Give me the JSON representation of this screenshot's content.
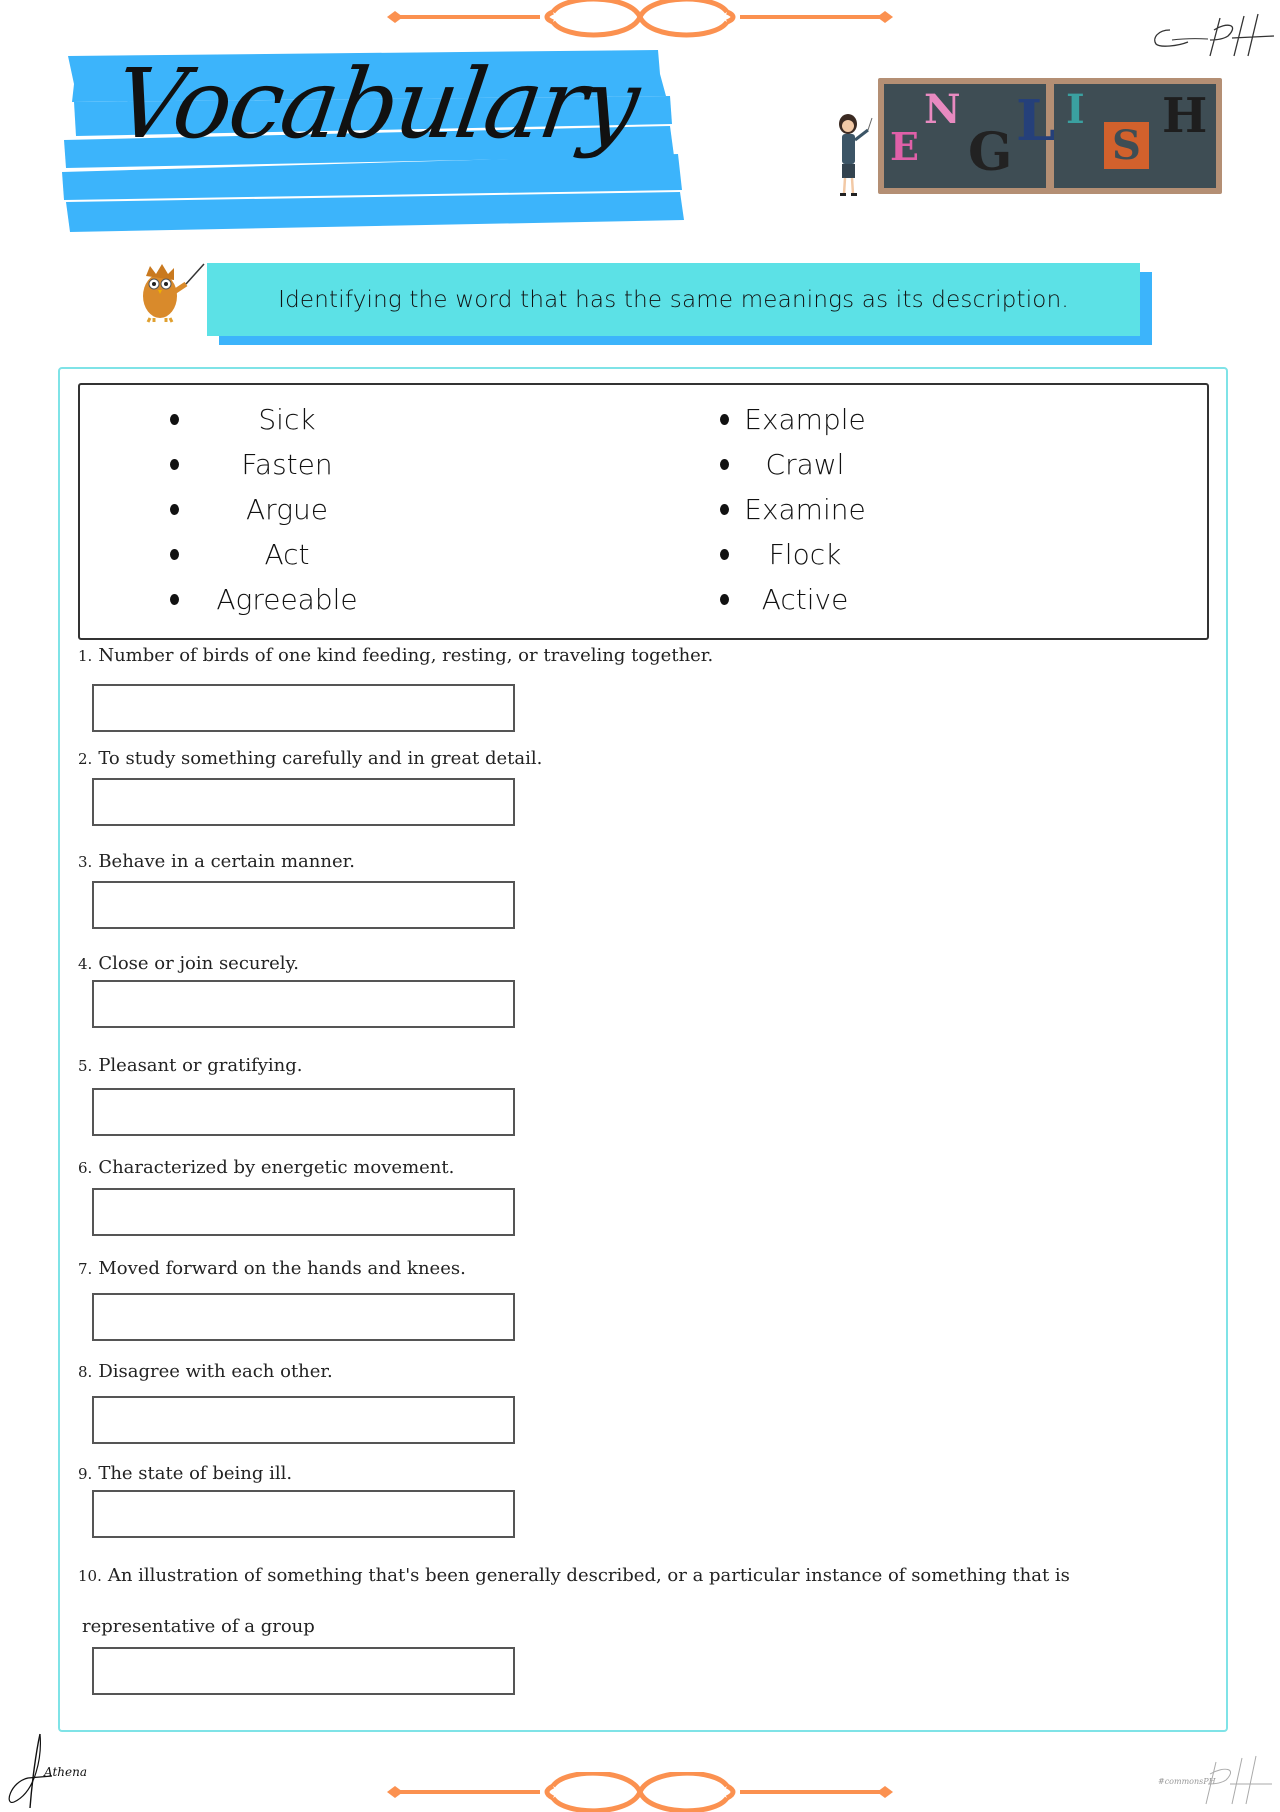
{
  "header": {
    "title": "Vocabulary",
    "title_banner_color": "#3cb4fb",
    "board_word": "ENGLISH",
    "board_letters": [
      "E",
      "N",
      "G",
      "L",
      "I",
      "S",
      "H"
    ],
    "top_signature": "CommonPH"
  },
  "instruction": {
    "text": "Identifying the word that has the same meanings as its description.",
    "box_color": "#5ce1e6",
    "shadow_color": "#3cb4fb",
    "mascot_icon": "owl-teacher-icon"
  },
  "word_bank": {
    "left": [
      "Sick",
      "Fasten",
      "Argue",
      "Act",
      "Agreeable"
    ],
    "right": [
      "Example",
      "Crawl",
      "Examine",
      "Flock",
      "Active"
    ]
  },
  "questions": [
    {
      "number": "1.",
      "text": "Number of birds of one kind feeding, resting, or traveling together.",
      "answer": ""
    },
    {
      "number": "2.",
      "text": "To study something carefully and in great detail.",
      "answer": ""
    },
    {
      "number": "3.",
      "text": "Behave in a certain manner.",
      "answer": ""
    },
    {
      "number": "4.",
      "text": "Close or join securely.",
      "answer": ""
    },
    {
      "number": "5.",
      "text": "Pleasant or gratifying.",
      "answer": ""
    },
    {
      "number": "6.",
      "text": "Characterized by energetic movement.",
      "answer": ""
    },
    {
      "number": "7.",
      "text": "Moved forward on the hands and knees.",
      "answer": ""
    },
    {
      "number": "8.",
      "text": "Disagree with each other.",
      "answer": ""
    },
    {
      "number": "9.",
      "text": "The state of being ill.",
      "answer": ""
    },
    {
      "number": "10.",
      "text": "An illustration of something that's been generally described, or a particular instance of something that is",
      "text_line2": "representative of a group",
      "answer": ""
    }
  ],
  "footer": {
    "left_signature": "Athena",
    "right_signature": "#commonsPH"
  },
  "colors": {
    "ornament": "#fb9150",
    "frame": "#7fe3e7"
  }
}
